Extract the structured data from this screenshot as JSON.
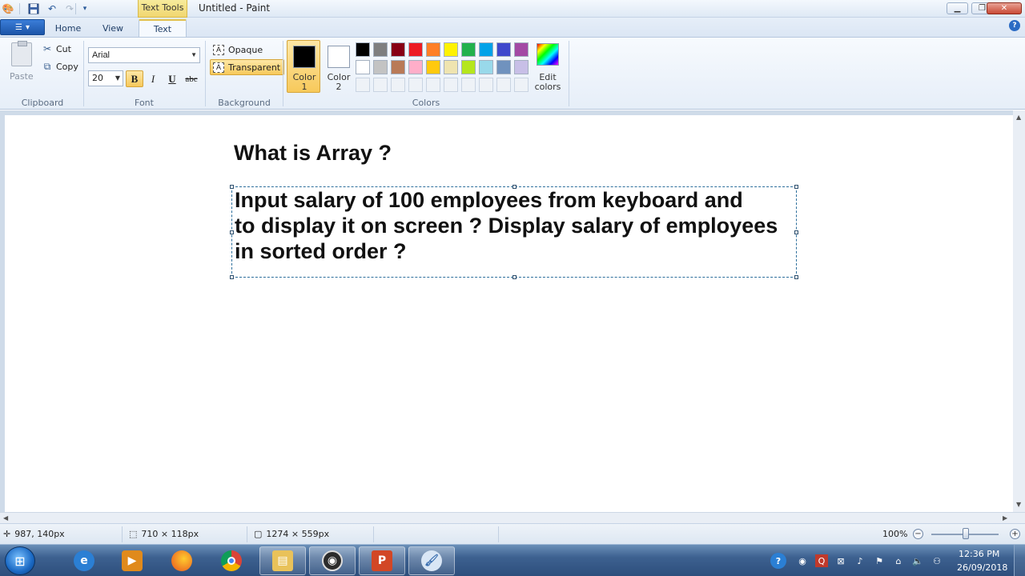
{
  "window": {
    "title": "Untitled - Paint",
    "context_tab": "Text Tools"
  },
  "ribbon": {
    "tabs": [
      {
        "label": "Home"
      },
      {
        "label": "View"
      },
      {
        "label": "Text"
      }
    ],
    "active_tab": "Text",
    "clipboard": {
      "paste_label": "Paste",
      "cut_label": "Cut",
      "copy_label": "Copy",
      "group_label": "Clipboard"
    },
    "font": {
      "family": "Arial",
      "size": "20",
      "bold_label": "B",
      "italic_label": "I",
      "underline_label": "U",
      "strike_label": "abc",
      "bold_active": true,
      "group_label": "Font"
    },
    "background": {
      "opaque_label": "Opaque",
      "transparent_label": "Transparent",
      "selected": "Transparent",
      "group_label": "Background"
    },
    "colors": {
      "color1_label_line1": "Color",
      "color1_label_line2": "1",
      "color2_label_line1": "Color",
      "color2_label_line2": "2",
      "color1_value": "#000000",
      "color2_value": "#ffffff",
      "edit_label_line1": "Edit",
      "edit_label_line2": "colors",
      "group_label": "Colors",
      "palette_row1": [
        "#000000",
        "#7f7f7f",
        "#880015",
        "#ed1c24",
        "#ff7f27",
        "#fff200",
        "#22b14c",
        "#00a2e8",
        "#3f48cc",
        "#a349a4"
      ],
      "palette_row2": [
        "#ffffff",
        "#c3c3c3",
        "#b97a57",
        "#ffaec9",
        "#ffc90e",
        "#efe4b0",
        "#b5e61d",
        "#99d9ea",
        "#7092be",
        "#c8bfe7"
      ],
      "palette_row3": [
        "#eef2f7",
        "#eef2f7",
        "#eef2f7",
        "#eef2f7",
        "#eef2f7",
        "#eef2f7",
        "#eef2f7",
        "#eef2f7",
        "#eef2f7",
        "#eef2f7"
      ]
    }
  },
  "canvas": {
    "heading": "What is Array ?",
    "textbox_content": "Input salary of 100 employees from keyboard and\nto display it on screen ? Display salary of employees\nin sorted order ?"
  },
  "statusbar": {
    "cursor_position": "987, 140px",
    "selection_size": "710 × 118px",
    "image_size": "1274 × 559px",
    "zoom": "100%",
    "zoom_level": 1.0
  },
  "taskbar": {
    "apps": [
      {
        "icon": "internet-explorer-icon"
      },
      {
        "icon": "media-player-icon"
      },
      {
        "icon": "firefox-icon"
      },
      {
        "icon": "chrome-icon"
      },
      {
        "icon": "file-explorer-icon"
      },
      {
        "icon": "obs-icon"
      },
      {
        "icon": "powerpoint-icon"
      },
      {
        "icon": "paint-icon"
      }
    ],
    "clock_time": "12:36 PM",
    "clock_date": "26/09/2018"
  }
}
